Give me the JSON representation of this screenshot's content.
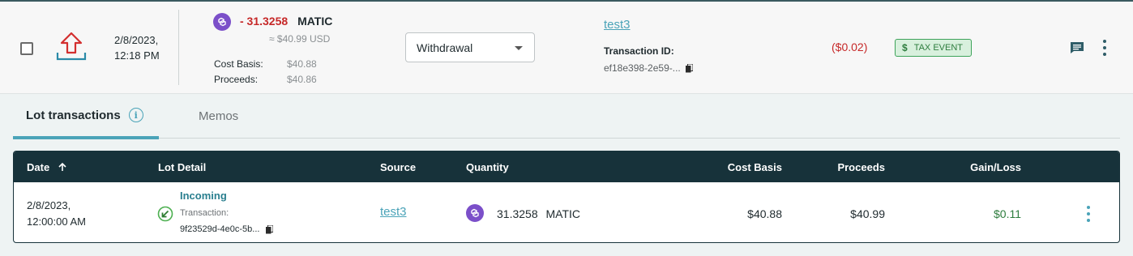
{
  "transaction": {
    "date_line1": "2/8/2023,",
    "date_line2": "12:18 PM",
    "amount": "- 31.3258",
    "asset": "MATIC",
    "usd_approx": "≈ $40.99 USD",
    "cost_basis_label": "Cost Basis:",
    "cost_basis_value": "$40.88",
    "proceeds_label": "Proceeds:",
    "proceeds_value": "$40.86",
    "type_selected": "Withdrawal",
    "wallet": "test3",
    "txid_label": "Transaction ID:",
    "txid_value": "ef18e398-2e59-...",
    "gain_loss": "($0.02)",
    "tax_badge": "TAX EVENT",
    "tax_badge_symbol": "$"
  },
  "tabs": {
    "lot": "Lot transactions",
    "memos": "Memos",
    "info_symbol": "i"
  },
  "table": {
    "headers": {
      "date": "Date",
      "lot_detail": "Lot Detail",
      "source": "Source",
      "quantity": "Quantity",
      "cost_basis": "Cost Basis",
      "proceeds": "Proceeds",
      "gain_loss": "Gain/Loss"
    },
    "rows": [
      {
        "date_line1": "2/8/2023,",
        "date_line2": "12:00:00 AM",
        "lot_type": "Incoming",
        "tx_label": "Transaction:",
        "tx_value": "9f23529d-4e0c-5b...",
        "source": "test3",
        "quantity": "31.3258",
        "asset": "MATIC",
        "cost_basis": "$40.88",
        "proceeds": "$40.99",
        "gain_loss": "$0.11"
      }
    ]
  },
  "colors": {
    "negative": "#c62828",
    "positive": "#2e7d3e",
    "accent": "#4aa3b8",
    "header_bg": "#17323a",
    "matic": "#7b4fc9"
  },
  "icons": {
    "withdraw": "upload-arrow-icon",
    "asset": "polygon-matic-icon",
    "copy": "copy-icon",
    "chat": "comment-icon",
    "more": "kebab-icon",
    "sort": "arrow-up-icon",
    "incoming": "incoming-arrow-icon"
  }
}
